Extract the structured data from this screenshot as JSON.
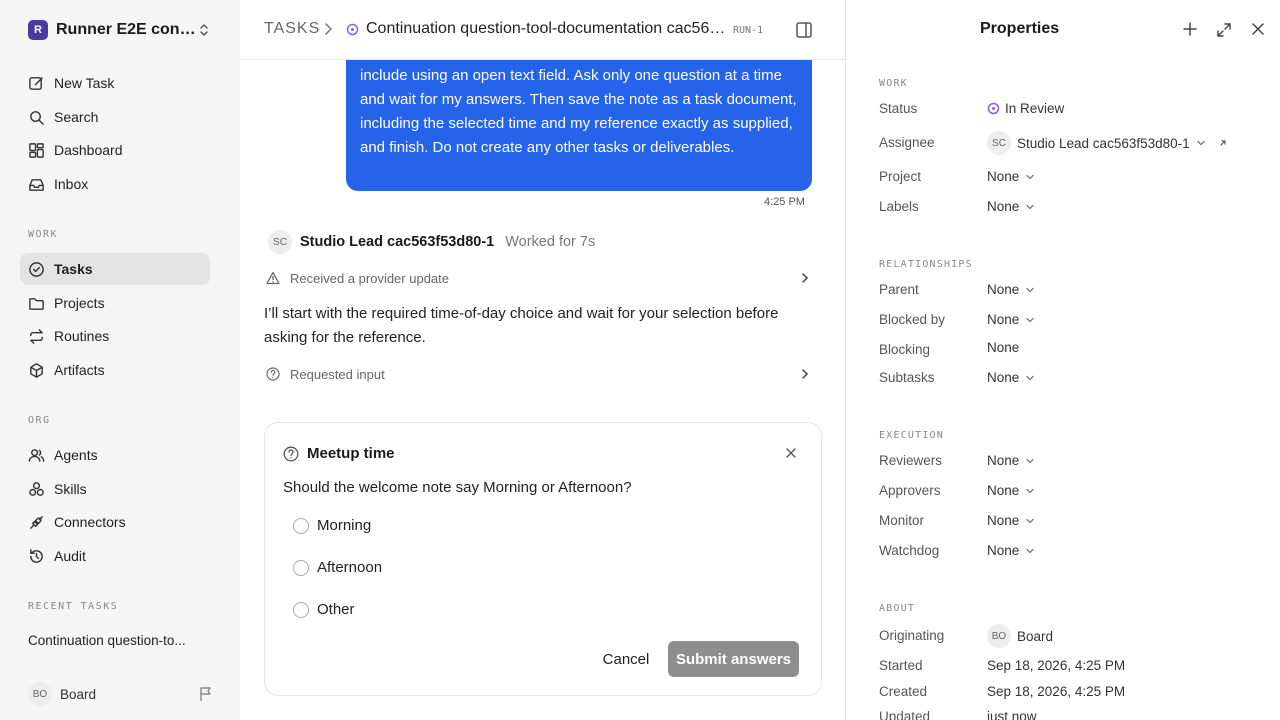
{
  "sidebar": {
    "workspace": {
      "logo": "R",
      "name": "Runner E2E conti..."
    },
    "nav_top": [
      {
        "label": "New Task",
        "icon": "edit-icon"
      },
      {
        "label": "Search",
        "icon": "search-icon"
      },
      {
        "label": "Dashboard",
        "icon": "dashboard-icon"
      },
      {
        "label": "Inbox",
        "icon": "inbox-icon"
      }
    ],
    "work_label": "WORK",
    "work_items": [
      {
        "label": "Tasks",
        "icon": "check-circle-icon",
        "active": true
      },
      {
        "label": "Projects",
        "icon": "folder-icon"
      },
      {
        "label": "Routines",
        "icon": "repeat-icon"
      },
      {
        "label": "Artifacts",
        "icon": "box-icon"
      }
    ],
    "org_label": "ORG",
    "org_items": [
      {
        "label": "Agents",
        "icon": "users-icon"
      },
      {
        "label": "Skills",
        "icon": "skills-icon"
      },
      {
        "label": "Connectors",
        "icon": "plug-icon"
      },
      {
        "label": "Audit",
        "icon": "history-icon"
      }
    ],
    "recent_label": "RECENT TASKS",
    "recent_task": "Continuation question-to...",
    "user": {
      "initials": "BO",
      "name": "Board"
    }
  },
  "header": {
    "section": "TASKS",
    "title": "Continuation question-tool-documentation cac563f5...",
    "run": "RUN-1"
  },
  "thread": {
    "user_message": "include using an open text field. Ask only one question at a time and wait for my answers. Then save the note as a task document, including the selected time and my reference exactly as supplied, and finish. Do not create any other tasks or deliverables.",
    "timestamp": "4:25 PM",
    "agent": {
      "initials": "SC",
      "name": "Studio Lead cac563f53d80-1",
      "worked": "Worked for 7s"
    },
    "event_update": "Received a provider update",
    "agent_reply": "I’ll start with the required time-of-day choice and wait for your selection before asking for the reference.",
    "event_input": "Requested input"
  },
  "question_card": {
    "title": "Meetup time",
    "question": "Should the welcome note say Morning or Afternoon?",
    "options": [
      "Morning",
      "Afternoon",
      "Other"
    ],
    "cancel_label": "Cancel",
    "submit_label": "Submit answers"
  },
  "properties": {
    "title": "Properties",
    "work_label": "WORK",
    "status_label": "Status",
    "status_value": "In Review",
    "assignee_label": "Assignee",
    "assignee_initials": "SC",
    "assignee_value": "Studio Lead cac563f53d80-1",
    "project_label": "Project",
    "project_value": "None",
    "labels_label": "Labels",
    "labels_value": "None",
    "relationships_label": "RELATIONSHIPS",
    "parent_label": "Parent",
    "parent_value": "None",
    "blocked_by_label": "Blocked by",
    "blocked_by_value": "None",
    "blocking_label": "Blocking",
    "blocking_value": "None",
    "subtasks_label": "Subtasks",
    "subtasks_value": "None",
    "execution_label": "EXECUTION",
    "reviewers_label": "Reviewers",
    "reviewers_value": "None",
    "approvers_label": "Approvers",
    "approvers_value": "None",
    "monitor_label": "Monitor",
    "monitor_value": "None",
    "watchdog_label": "Watchdog",
    "watchdog_value": "None",
    "about_label": "ABOUT",
    "originating_label": "Originating",
    "originating_initials": "BO",
    "originating_value": "Board",
    "started_label": "Started",
    "started_value": "Sep 18, 2026, 4:25 PM",
    "created_label": "Created",
    "created_value": "Sep 18, 2026, 4:25 PM",
    "updated_label": "Updated",
    "updated_value": "just now"
  },
  "colors": {
    "accent": "#2563eb",
    "status_purple": "#8b5cf6",
    "submit_disabled": "#8e8e8e",
    "sidebar_bg": "#f5f5f5"
  }
}
